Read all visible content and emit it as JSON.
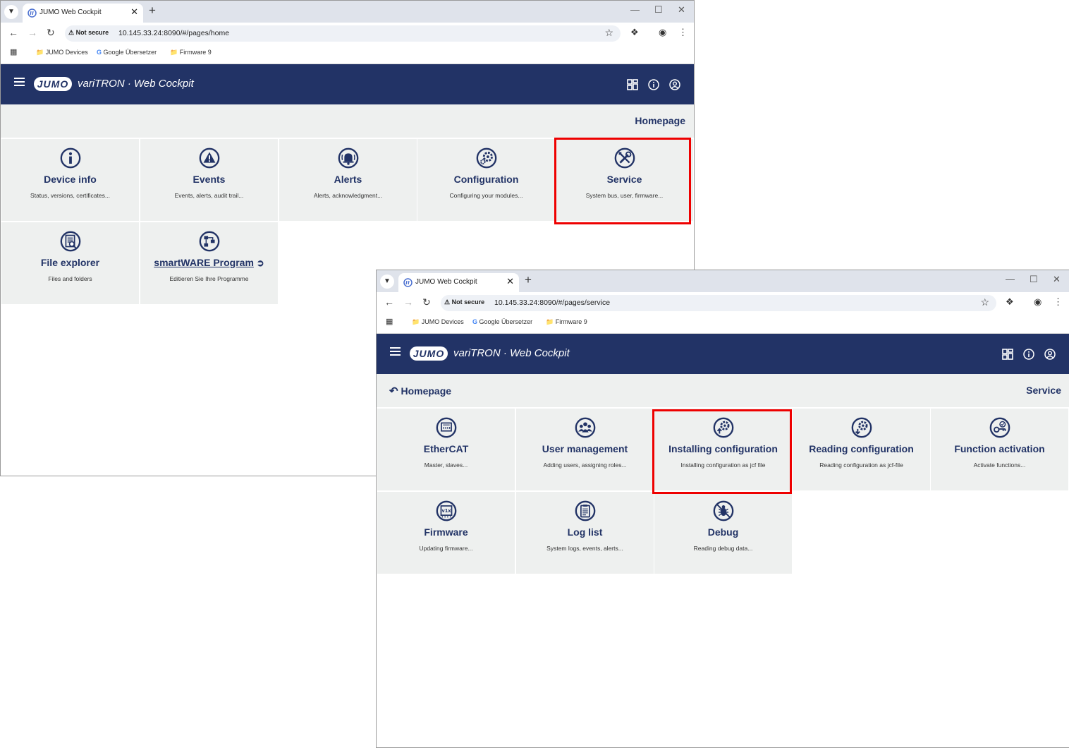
{
  "window_home": {
    "tab_title": "JUMO Web Cockpit",
    "security": "Not secure",
    "url": "10.145.33.24:8090/#/pages/home",
    "bookmarks": [
      "JUMO Devices",
      "Google Übersetzer",
      "Firmware 9"
    ],
    "app": {
      "logo": "JUMO",
      "brand": "variTRON · Web Cockpit"
    },
    "page_title": "Homepage",
    "tiles": [
      {
        "title": "Device info",
        "subtitle": "Status, versions, certificates...",
        "icon": "info-icon"
      },
      {
        "title": "Events",
        "subtitle": "Events, alerts, audit trail...",
        "icon": "warning-icon"
      },
      {
        "title": "Alerts",
        "subtitle": "Alerts, acknowledgment...",
        "icon": "bell-icon"
      },
      {
        "title": "Configuration",
        "subtitle": "Configuring your modules...",
        "icon": "gear-icon"
      },
      {
        "title": "Service",
        "subtitle": "System bus, user, firmware...",
        "icon": "tools-icon"
      },
      {
        "title": "File explorer",
        "subtitle": "Files and folders",
        "icon": "file-search-icon"
      },
      {
        "title": "smartWARE Program",
        "subtitle": "Editieren Sie Ihre Programme",
        "icon": "flowchart-icon"
      }
    ]
  },
  "window_service": {
    "tab_title": "JUMO Web Cockpit",
    "security": "Not secure",
    "url": "10.145.33.24:8090/#/pages/service",
    "bookmarks": [
      "JUMO Devices",
      "Google Übersetzer",
      "Firmware 9"
    ],
    "app": {
      "logo": "JUMO",
      "brand": "variTRON · Web Cockpit"
    },
    "back_label": "Homepage",
    "page_title": "Service",
    "tiles": [
      {
        "title": "EtherCAT",
        "subtitle": "Master, slaves...",
        "icon": "ethernet-port-icon"
      },
      {
        "title": "User management",
        "subtitle": "Adding users, assigning roles...",
        "icon": "users-icon"
      },
      {
        "title": "Installing configuration",
        "subtitle": "Installing configuration as jcf file",
        "icon": "gear-upload-icon"
      },
      {
        "title": "Reading configuration",
        "subtitle": "Reading configuration as jcf-file",
        "icon": "gear-download-icon"
      },
      {
        "title": "Function activation",
        "subtitle": "Activate functions...",
        "icon": "key-check-icon"
      },
      {
        "title": "Firmware",
        "subtitle": "Updating firmware...",
        "icon": "firmware-chip-icon"
      },
      {
        "title": "Log list",
        "subtitle": "System logs, events, alerts...",
        "icon": "log-list-icon"
      },
      {
        "title": "Debug",
        "subtitle": "Reading debug data...",
        "icon": "bug-icon"
      }
    ]
  },
  "colors": {
    "primary": "#223366",
    "tile_bg": "#eef0ef",
    "highlight": "#ee0000"
  }
}
